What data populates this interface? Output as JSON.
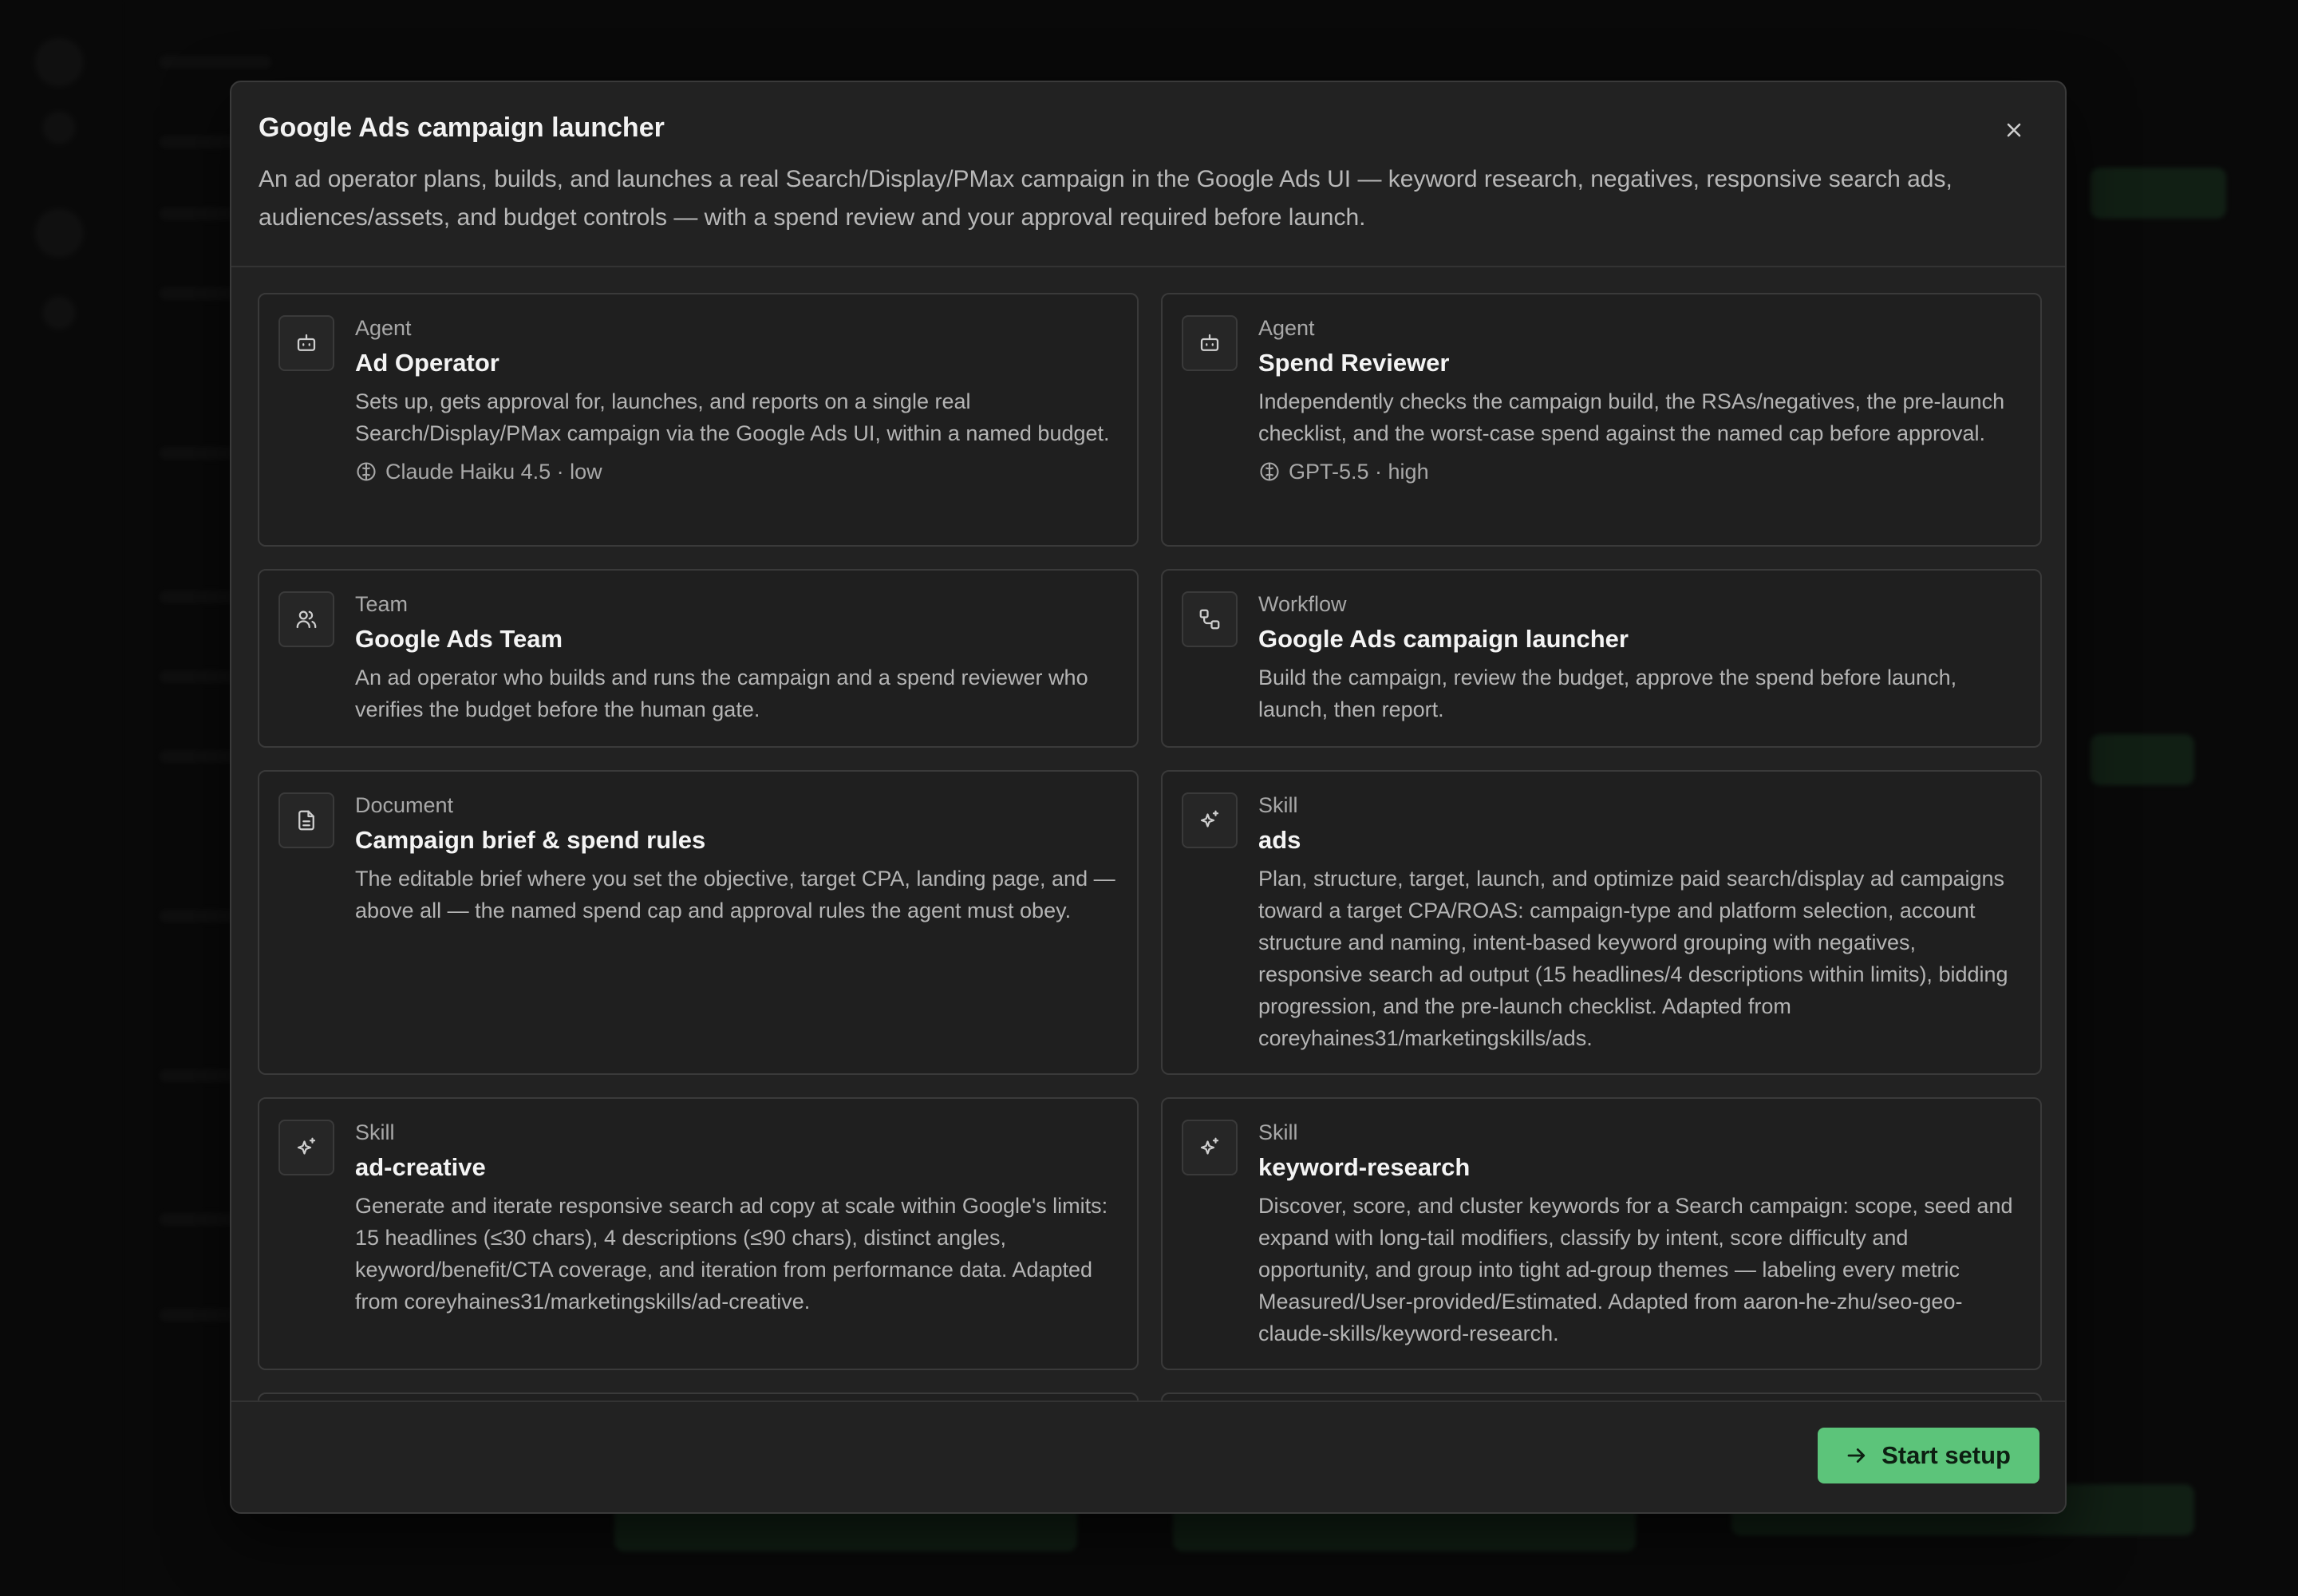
{
  "modal": {
    "title": "Google Ads campaign launcher",
    "subtitle": "An ad operator plans, builds, and launches a real Search/Display/PMax campaign in the Google Ads UI — keyword research, negatives, responsive search ads, audiences/assets, and budget controls — with a spend review and your approval required before launch.",
    "close_icon": "close-icon"
  },
  "cards": [
    {
      "type": "Agent",
      "icon": "robot-icon",
      "name": "Ad Operator",
      "description": "Sets up, gets approval for, launches, and reports on a single real Search/Display/PMax campaign via the Google Ads UI, within a named budget.",
      "model": "Claude Haiku 4.5 · low",
      "model_icon": "model-icon"
    },
    {
      "type": "Agent",
      "icon": "robot-icon",
      "name": "Spend Reviewer",
      "description": "Independently checks the campaign build, the RSAs/negatives, the pre-launch checklist, and the worst-case spend against the named cap before approval.",
      "model": "GPT-5.5 · high",
      "model_icon": "model-icon"
    },
    {
      "type": "Team",
      "icon": "users-icon",
      "name": "Google Ads Team",
      "description": "An ad operator who builds and runs the campaign and a spend reviewer who verifies the budget before the human gate."
    },
    {
      "type": "Workflow",
      "icon": "workflow-icon",
      "name": "Google Ads campaign launcher",
      "description": "Build the campaign, review the budget, approve the spend before launch, launch, then report."
    },
    {
      "type": "Document",
      "icon": "document-icon",
      "name": "Campaign brief & spend rules",
      "description": "The editable brief where you set the objective, target CPA, landing page, and — above all — the named spend cap and approval rules the agent must obey."
    },
    {
      "type": "Skill",
      "icon": "sparkle-icon",
      "name": "ads",
      "description": "Plan, structure, target, launch, and optimize paid search/display ad campaigns toward a target CPA/ROAS: campaign-type and platform selection, account structure and naming, intent-based keyword grouping with negatives, responsive search ad output (15 headlines/4 descriptions within limits), bidding progression, and the pre-launch checklist. Adapted from coreyhaines31/marketingskills/ads."
    },
    {
      "type": "Skill",
      "icon": "sparkle-icon",
      "name": "ad-creative",
      "description": "Generate and iterate responsive search ad copy at scale within Google's limits: 15 headlines (≤30 chars), 4 descriptions (≤90 chars), distinct angles, keyword/benefit/CTA coverage, and iteration from performance data. Adapted from coreyhaines31/marketingskills/ad-creative."
    },
    {
      "type": "Skill",
      "icon": "sparkle-icon",
      "name": "keyword-research",
      "description": "Discover, score, and cluster keywords for a Search campaign: scope, seed and expand with long-tail modifiers, classify by intent, score difficulty and opportunity, and group into tight ad-group themes — labeling every metric Measured/User-provided/Estimated. Adapted from aaron-he-zhu/seo-geo-claude-skills/keyword-research."
    }
  ],
  "footer": {
    "start_label": "Start setup",
    "start_icon": "arrow-right-icon"
  },
  "colors": {
    "accent": "#5cc47a",
    "modal_bg": "#222222",
    "card_bg": "#1f1f1f",
    "border": "#3a3a3a"
  }
}
